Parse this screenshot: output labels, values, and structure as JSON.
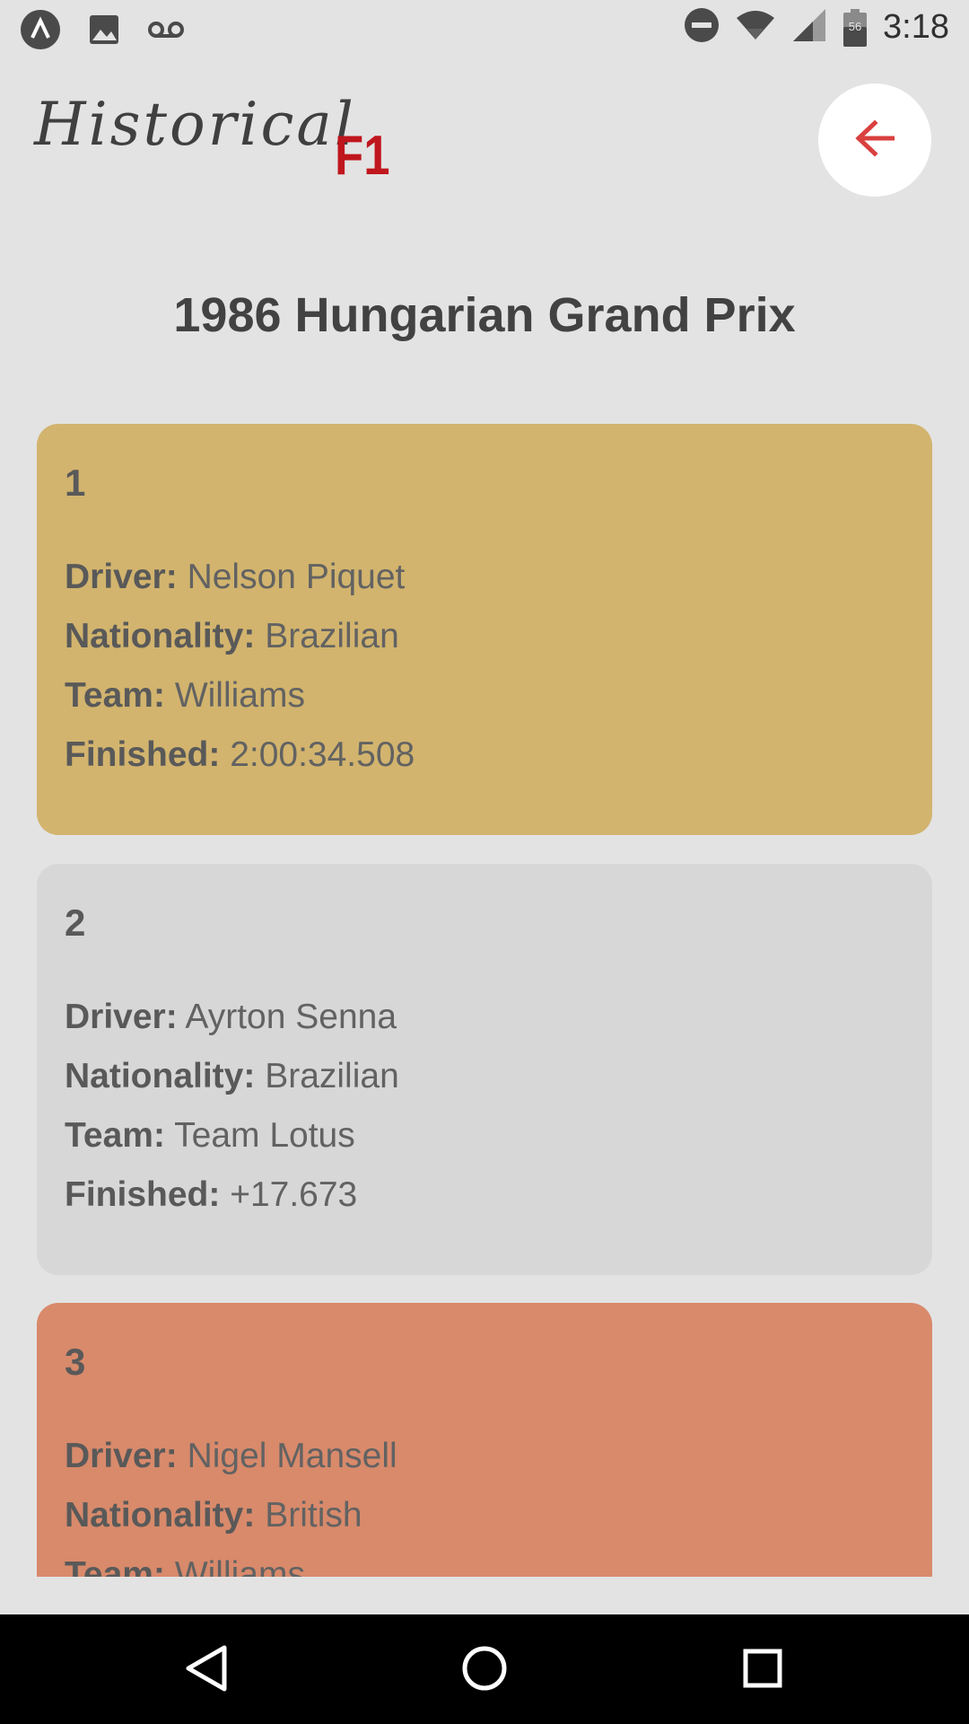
{
  "status_bar": {
    "time": "3:18",
    "battery_level": "56",
    "icons": [
      "app-launcher-icon",
      "image-icon",
      "voicemail-icon",
      "do-not-disturb-icon",
      "wifi-icon",
      "cell-signal-icon",
      "battery-icon"
    ]
  },
  "header": {
    "logo_text": "Historical",
    "logo_badge": "F1",
    "back_icon": "arrow-left-icon",
    "accent_color": "#d9403e"
  },
  "race": {
    "title": "1986 Hungarian Grand Prix"
  },
  "labels": {
    "driver": "Driver:",
    "nationality": "Nationality:",
    "team": "Team:",
    "finished": "Finished:"
  },
  "results": [
    {
      "position": "1",
      "driver": "Nelson Piquet",
      "nationality": "Brazilian",
      "team": "Williams",
      "finished": "2:00:34.508",
      "color": "#d2b46e"
    },
    {
      "position": "2",
      "driver": "Ayrton Senna",
      "nationality": "Brazilian",
      "team": "Team Lotus",
      "finished": "+17.673",
      "color": "#d7d7d7"
    },
    {
      "position": "3",
      "driver": "Nigel Mansell",
      "nationality": "British",
      "team": "Williams",
      "finished": "",
      "color": "#d88a6b"
    }
  ],
  "nav_bar": {
    "buttons": [
      "back-triangle-icon",
      "home-circle-icon",
      "recents-square-icon"
    ]
  }
}
